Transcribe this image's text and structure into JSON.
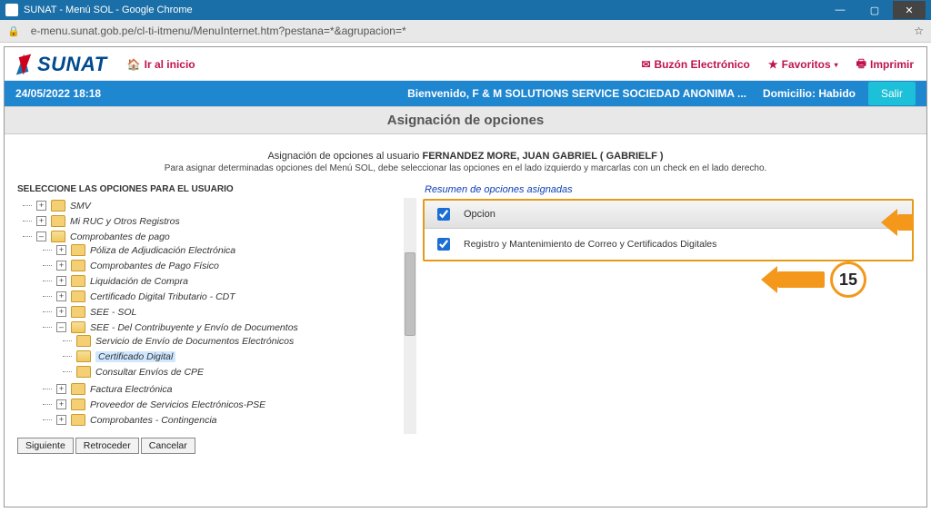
{
  "window": {
    "title": "SUNAT - Menú SOL - Google Chrome",
    "url": "e-menu.sunat.gob.pe/cl-ti-itmenu/MenuInternet.htm?pestana=*&agrupacion=*",
    "min_icon": "—",
    "max_icon": "▢",
    "close_icon": "✕",
    "lock_icon": "🔒",
    "star_icon": "☆"
  },
  "header": {
    "logo_text": "SUNAT",
    "home_label": "Ir al inicio",
    "home_icon": "🏠",
    "actions": {
      "inbox_label": "Buzón Electrónico",
      "inbox_icon": "✉",
      "fav_label": "Favoritos",
      "fav_icon": "★",
      "fav_caret": "▾",
      "print_label": "Imprimir",
      "print_icon": "🖶"
    }
  },
  "bluebar": {
    "datetime": "24/05/2022 18:18",
    "welcome": "Bienvenido, F & M SOLUTIONS SERVICE SOCIEDAD ANONIMA ...",
    "domicilio": "Domicilio: Habido",
    "salir": "Salir"
  },
  "section_title": "Asignación de opciones",
  "intro_prefix": "Asignación de opciones al usuario ",
  "intro_user": "FERNANDEZ MORE, JUAN GABRIEL ( GABRIELF )",
  "intro_note": "Para asignar determinadas opciones del Menú SOL, debe seleccionar las opciones en el lado izquierdo y marcarlas con un check en el lado derecho.",
  "left_title": "SELECCIONE LAS OPCIONES PARA EL USUARIO",
  "tree": {
    "smv": "SMV",
    "mi_ruc": "Mi RUC y Otros Registros",
    "comp_pago": "Comprobantes de pago",
    "poliza": "Póliza de Adjudicación Electrónica",
    "comp_fisico": "Comprobantes de Pago Físico",
    "liquidacion": "Liquidación de Compra",
    "cert_trib": "Certificado Digital Tributario - CDT",
    "see_sol": "SEE - SOL",
    "see_contrib": "SEE - Del Contribuyente y Envío de Documentos",
    "serv_envio": "Servicio de Envío de Documentos Electrónicos",
    "cert_digital": "Certificado Digital",
    "consultar_envios": "Consultar Envíos de CPE",
    "factura": "Factura Electrónica",
    "proveedor": "Proveedor de Servicios Electrónicos-PSE",
    "contingencia": "Comprobantes - Contingencia",
    "toggle_minus": "–",
    "toggle_plus": "+"
  },
  "summary_title": "Resumen de opciones asignadas",
  "summary_header": "Opcion",
  "summary_row1": "Registro y Mantenimiento de Correo y Certificados Digitales",
  "buttons": {
    "siguiente": "Siguiente",
    "retroceder": "Retroceder",
    "cancelar": "Cancelar"
  },
  "callout_number": "15"
}
